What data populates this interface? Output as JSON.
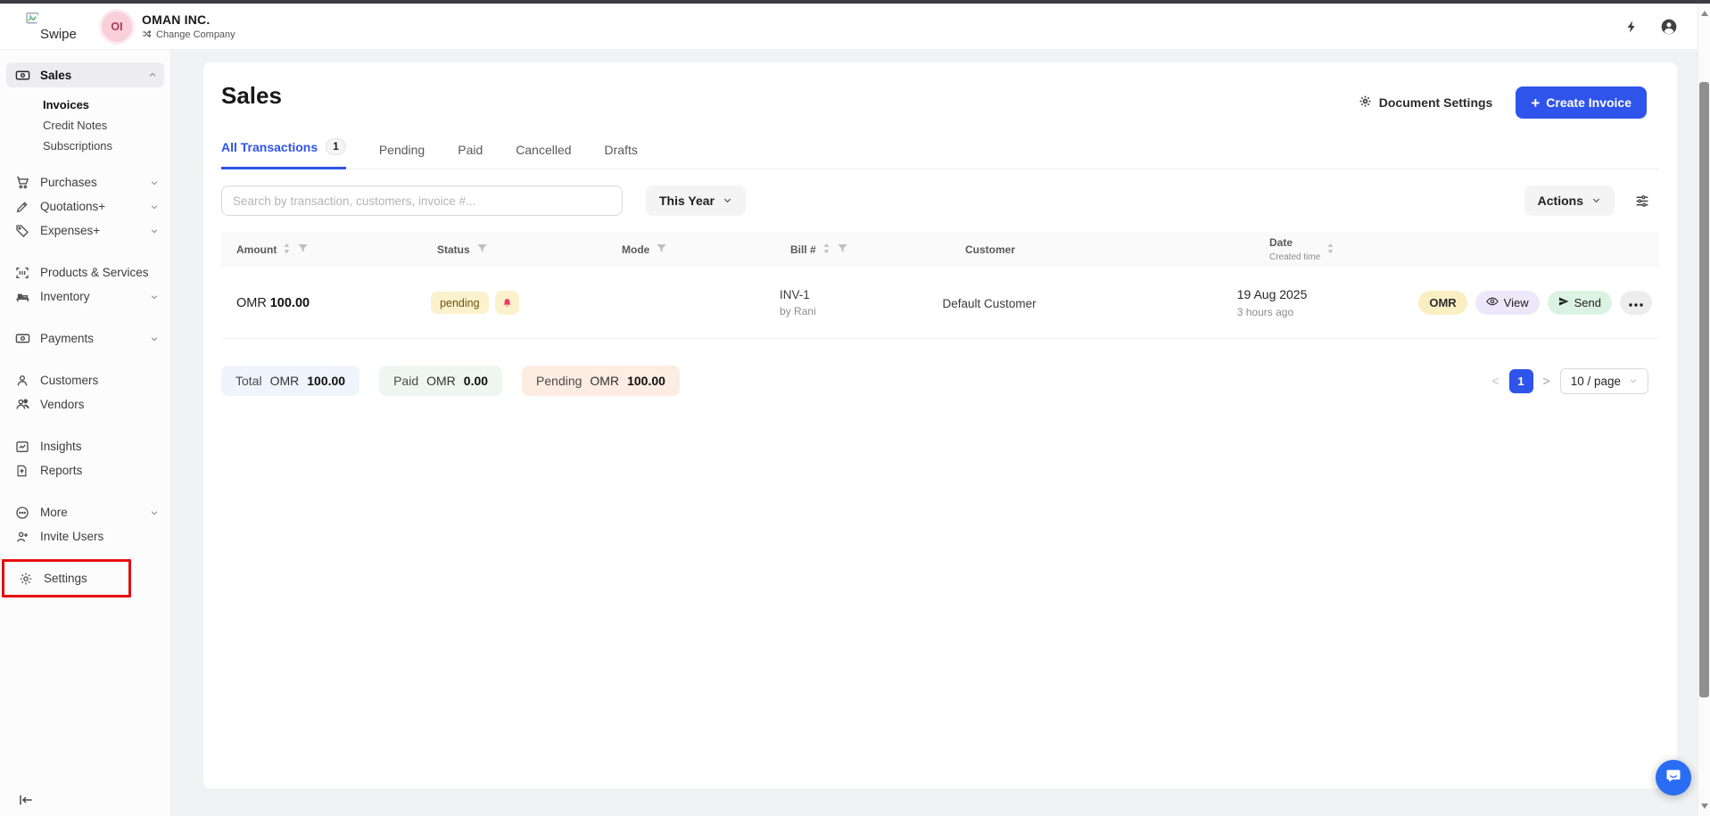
{
  "topbar": {
    "logo_text": "Swipe",
    "company_avatar": "OI",
    "company_name": "OMAN INC.",
    "change_company": "Change Company"
  },
  "sidebar": {
    "sales": "Sales",
    "invoices": "Invoices",
    "credit_notes": "Credit Notes",
    "subscriptions": "Subscriptions",
    "purchases": "Purchases",
    "quotations": "Quotations+",
    "expenses": "Expenses+",
    "products_services": "Products & Services",
    "inventory": "Inventory",
    "payments": "Payments",
    "customers": "Customers",
    "vendors": "Vendors",
    "insights": "Insights",
    "reports": "Reports",
    "more": "More",
    "invite_users": "Invite Users",
    "settings": "Settings"
  },
  "page": {
    "title": "Sales"
  },
  "header_actions": {
    "document_settings": "Document Settings",
    "create_invoice_plus": "+",
    "create_invoice": "Create Invoice"
  },
  "tabs": {
    "all": {
      "label": "All Transactions",
      "badge": "1"
    },
    "pending": "Pending",
    "paid": "Paid",
    "cancelled": "Cancelled",
    "drafts": "Drafts"
  },
  "toolbar": {
    "search_placeholder": "Search by transaction, customers, invoice #...",
    "date_filter": "This Year",
    "actions": "Actions"
  },
  "table": {
    "headers": {
      "amount": "Amount",
      "status": "Status",
      "mode": "Mode",
      "bill": "Bill #",
      "customer": "Customer",
      "date": "Date",
      "date_sub": "Created time"
    },
    "rows": [
      {
        "amount_currency": "OMR",
        "amount": "100.00",
        "status": "pending",
        "bill_no": "INV-1",
        "bill_by": "by Rani",
        "customer": "Default Customer",
        "date": "19 Aug 2025",
        "created": "3 hours ago",
        "tag_currency": "OMR",
        "tag_view": "View",
        "tag_send": "Send"
      }
    ]
  },
  "summary": {
    "total_label": "Total",
    "total_currency": "OMR",
    "total_value": "100.00",
    "paid_label": "Paid",
    "paid_currency": "OMR",
    "paid_value": "0.00",
    "pending_label": "Pending",
    "pending_currency": "OMR",
    "pending_value": "100.00"
  },
  "pagination": {
    "prev": "<",
    "page": "1",
    "next": ">",
    "page_size": "10 / page"
  },
  "colors": {
    "accent_blue": "#2f54eb",
    "pending_tag_bg": "#fcf1cd",
    "currency_tag_bg": "#faeec3",
    "view_tag_bg": "#ece8fa",
    "send_tag_bg": "#dcf3e4",
    "total_chip_bg": "#f0f4fd",
    "paid_chip_bg": "#eff6f1",
    "pending_chip_bg": "#fcece1",
    "highlight_red": "#e60f0f",
    "chat_blue": "#2a6df4",
    "bell_red": "#f5365c"
  }
}
